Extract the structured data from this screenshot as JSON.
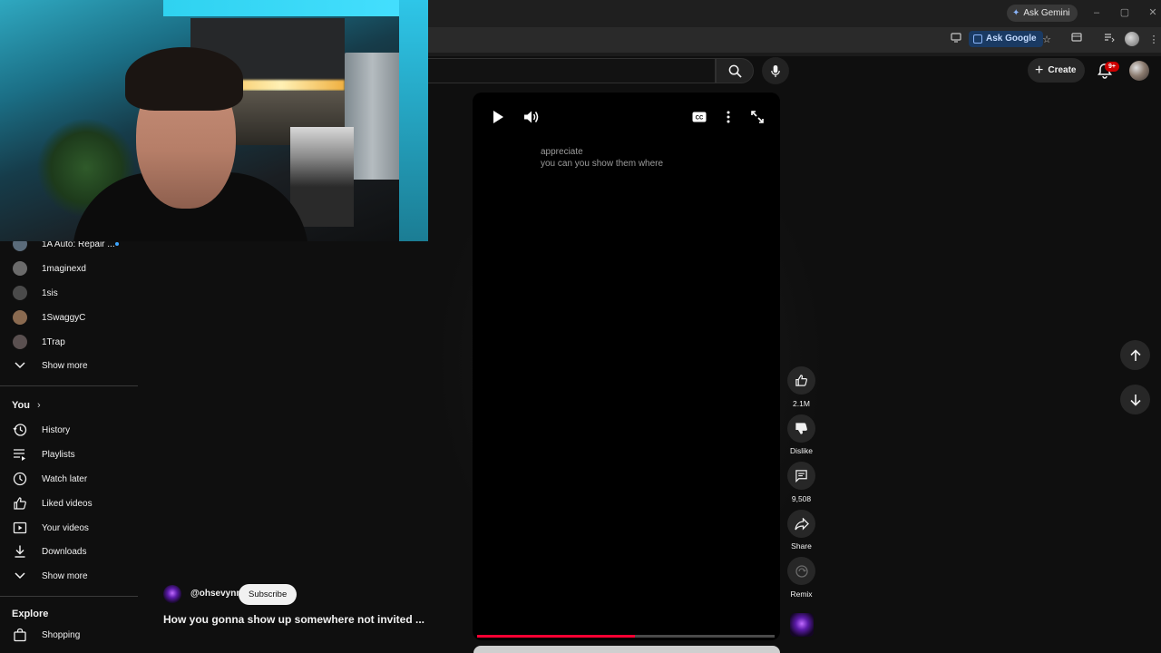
{
  "browser": {
    "gemini_label": "Ask Gemini",
    "ask_google_label": "Ask Google",
    "window_controls": [
      "–",
      "▢",
      "✕"
    ]
  },
  "header": {
    "create_label": "Create",
    "notification_count": "9+"
  },
  "sidebar": {
    "subscriptions": [
      {
        "label": "1A Auto: Repair ...",
        "color": "#5a6b7a",
        "new": true
      },
      {
        "label": "1maginexd",
        "color": "#6b6b6b",
        "new": false
      },
      {
        "label": "1sis",
        "color": "#4a4a4a",
        "new": false
      },
      {
        "label": "1SwaggyC",
        "color": "#8a6a50",
        "new": false
      },
      {
        "label": "1Trap",
        "color": "#5a5050",
        "new": false
      }
    ],
    "show_more_1": "Show more",
    "you_section": "You",
    "you_items": [
      {
        "label": "History",
        "icon": "history-icon"
      },
      {
        "label": "Playlists",
        "icon": "playlists-icon"
      },
      {
        "label": "Watch later",
        "icon": "clock-icon"
      },
      {
        "label": "Liked videos",
        "icon": "thumbs-up-icon"
      },
      {
        "label": "Your videos",
        "icon": "video-icon"
      },
      {
        "label": "Downloads",
        "icon": "download-icon"
      }
    ],
    "show_more_2": "Show more",
    "explore_section": "Explore",
    "explore_items": [
      {
        "label": "Shopping",
        "icon": "shopping-bag-icon"
      }
    ]
  },
  "player": {
    "caption_line1": "appreciate",
    "caption_line2": "you can you show them where",
    "progress": 0.53
  },
  "video": {
    "channel": "@ohsevynn",
    "subscribe_label": "Subscribe",
    "title": "How you gonna show up somewhere not invited ..."
  },
  "actions": {
    "like_count": "2.1M",
    "dislike_label": "Dislike",
    "comment_count": "9,508",
    "share_label": "Share",
    "remix_label": "Remix"
  },
  "colors": {
    "background": "#0f0f0f",
    "accent_red": "#ff0033",
    "link_blue": "#3ea6ff"
  }
}
